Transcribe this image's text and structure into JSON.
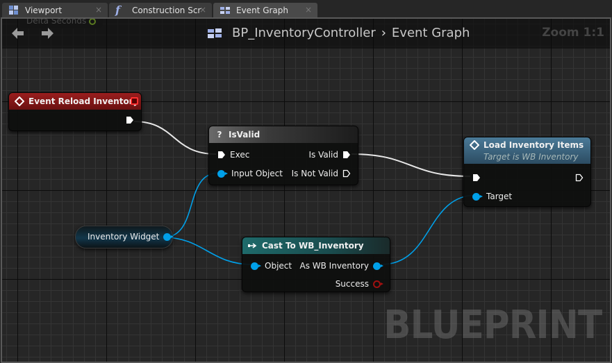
{
  "tabs": [
    {
      "label": "Viewport",
      "icon": "viewport-icon",
      "active": false
    },
    {
      "label": "Construction Scrip",
      "icon": "function-icon",
      "active": false
    },
    {
      "label": "Event Graph",
      "icon": "event-graph-icon",
      "active": true
    }
  ],
  "graph": {
    "breadcrumb": {
      "blueprint": "BP_InventoryController",
      "graph": "Event Graph"
    },
    "zoom": "Zoom 1:1",
    "watermark": "BLUEPRINT",
    "ghost_pin_label": "Delta Seconds"
  },
  "nodes": {
    "event_reload": {
      "title": "Event Reload Inventory",
      "color": "#8b1a1a"
    },
    "is_valid": {
      "title": "IsValid",
      "icon": "?",
      "pins": {
        "exec": "Exec",
        "input": "Input Object",
        "valid": "Is Valid",
        "not_valid": "Is Not Valid"
      }
    },
    "load_items": {
      "title": "Load Inventory Items",
      "subtitle": "Target is WB Inventory",
      "pins": {
        "target": "Target"
      }
    },
    "inventory_widget": {
      "label": "Inventory Widget"
    },
    "cast": {
      "title": "Cast To WB_Inventory",
      "pins": {
        "object": "Object",
        "as": "As WB Inventory",
        "success": "Success"
      }
    }
  },
  "colors": {
    "exec_wire": "#e8e8e8",
    "object_wire": "#00a0e9",
    "event_header": "#8b1a1a",
    "cast_header": "#1c5a5a",
    "function_header": "#3a6a86"
  }
}
